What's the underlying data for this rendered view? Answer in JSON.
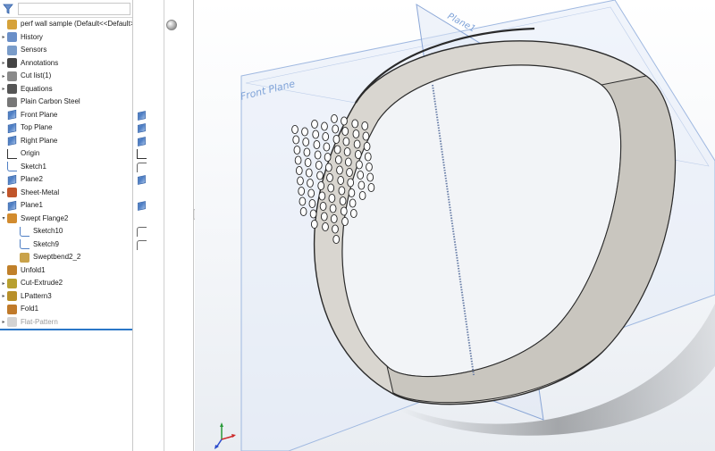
{
  "tree": {
    "items": [
      {
        "label": "perf wall sample  (Default<<Default>_",
        "icon": "part-icon",
        "expand": ""
      },
      {
        "label": "History",
        "icon": "history-icon",
        "expand": "▸"
      },
      {
        "label": "Sensors",
        "icon": "sensors-icon",
        "expand": ""
      },
      {
        "label": "Annotations",
        "icon": "annotations-icon",
        "expand": "▸"
      },
      {
        "label": "Cut list(1)",
        "icon": "cut-list-icon",
        "expand": "▸"
      },
      {
        "label": "Equations",
        "icon": "equations-icon",
        "expand": "▸"
      },
      {
        "label": "Plain Carbon Steel",
        "icon": "material-icon",
        "expand": ""
      },
      {
        "label": "Front Plane",
        "icon": "plane-icon",
        "expand": ""
      },
      {
        "label": "Top Plane",
        "icon": "plane-icon",
        "expand": ""
      },
      {
        "label": "Right Plane",
        "icon": "plane-icon",
        "expand": ""
      },
      {
        "label": "Origin",
        "icon": "origin-icon",
        "expand": ""
      },
      {
        "label": "Sketch1",
        "icon": "sketch-icon",
        "expand": ""
      },
      {
        "label": "Plane2",
        "icon": "plane-icon",
        "expand": ""
      },
      {
        "label": "Sheet-Metal",
        "icon": "sheet-metal-icon",
        "expand": "▸"
      },
      {
        "label": "Plane1",
        "icon": "plane-icon",
        "expand": ""
      },
      {
        "label": "Swept Flange2",
        "icon": "swept-flange-icon",
        "expand": "▾"
      },
      {
        "label": "Sketch10",
        "icon": "sketch-icon",
        "expand": "",
        "indent": 1
      },
      {
        "label": "Sketch9",
        "icon": "sketch-icon",
        "expand": "",
        "indent": 1
      },
      {
        "label": "Sweptbend2_2",
        "icon": "sweptbend-icon",
        "expand": "",
        "indent": 1
      },
      {
        "label": "Unfold1",
        "icon": "unfold-icon",
        "expand": ""
      },
      {
        "label": "Cut-Extrude2",
        "icon": "cut-extrude-icon",
        "expand": "▸"
      },
      {
        "label": "LPattern3",
        "icon": "linear-pattern-icon",
        "expand": "▸"
      },
      {
        "label": "Fold1",
        "icon": "fold-icon",
        "expand": ""
      },
      {
        "label": "Flat-Pattern",
        "icon": "flat-pattern-icon",
        "expand": "▸",
        "grey": true
      }
    ]
  },
  "viewport": {
    "front_plane_label": "Front Plane",
    "plane1_label": "Plane1"
  },
  "colors": {
    "plane_edge": "#9fb8e0",
    "plane_fill": "#dfe8f6",
    "ring_outer": "#d6d3cd",
    "ring_inner": "#c5c2bc",
    "ring_edge": "#2a2a2a",
    "hole_fill": "#ffffff",
    "selection_line": "#2b77c7"
  }
}
